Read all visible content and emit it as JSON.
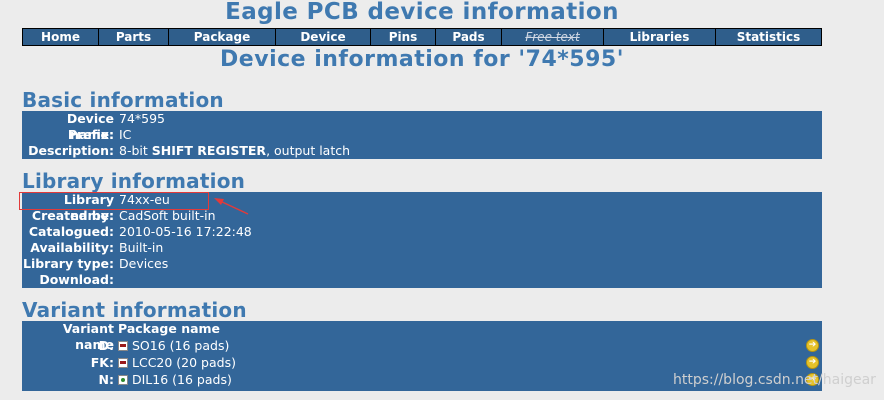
{
  "page_title": "Eagle PCB device information",
  "nav": [
    {
      "label": "Home",
      "disabled": false
    },
    {
      "label": "Parts",
      "disabled": false
    },
    {
      "label": "Package",
      "disabled": false
    },
    {
      "label": "Device",
      "disabled": false
    },
    {
      "label": "Pins",
      "disabled": false
    },
    {
      "label": "Pads",
      "disabled": false
    },
    {
      "label": "Free text",
      "disabled": true
    },
    {
      "label": "Libraries",
      "disabled": false
    },
    {
      "label": "Statistics",
      "disabled": false
    }
  ],
  "subtitle": "Device information for '74*595'",
  "basic": {
    "heading": "Basic information",
    "device_name_label": "Device name:",
    "device_name": "74*595",
    "prefix_label": "Prefix:",
    "prefix": "IC",
    "description_label": "Description:",
    "description_pre": "8-bit ",
    "description_bold": "SHIFT REGISTER",
    "description_post": ", output latch"
  },
  "library": {
    "heading": "Library information",
    "library_name_label": "Library name:",
    "library_name": "74xx-eu",
    "created_by_label": "Created by:",
    "created_by": "CadSoft built-in",
    "catalogued_label": "Catalogued:",
    "catalogued": "2010-05-16 17:22:48",
    "availability_label": "Availability:",
    "availability": "Built-in",
    "library_type_label": "Library type:",
    "library_type": "Devices",
    "download_label": "Download:",
    "download": ""
  },
  "variant": {
    "heading": "Variant information",
    "col_variant": "Variant name",
    "col_package": "Package name",
    "rows": [
      {
        "variant": "D:",
        "package": "SO16 (16 pads)",
        "icon": "red-package-icon"
      },
      {
        "variant": "FK:",
        "package": "LCC20 (20 pads)",
        "icon": "red-package-icon"
      },
      {
        "variant": "N:",
        "package": "DIL16 (16 pads)",
        "icon": "green-package-icon"
      }
    ]
  },
  "watermark": "https://blog.csdn.net/haigear"
}
